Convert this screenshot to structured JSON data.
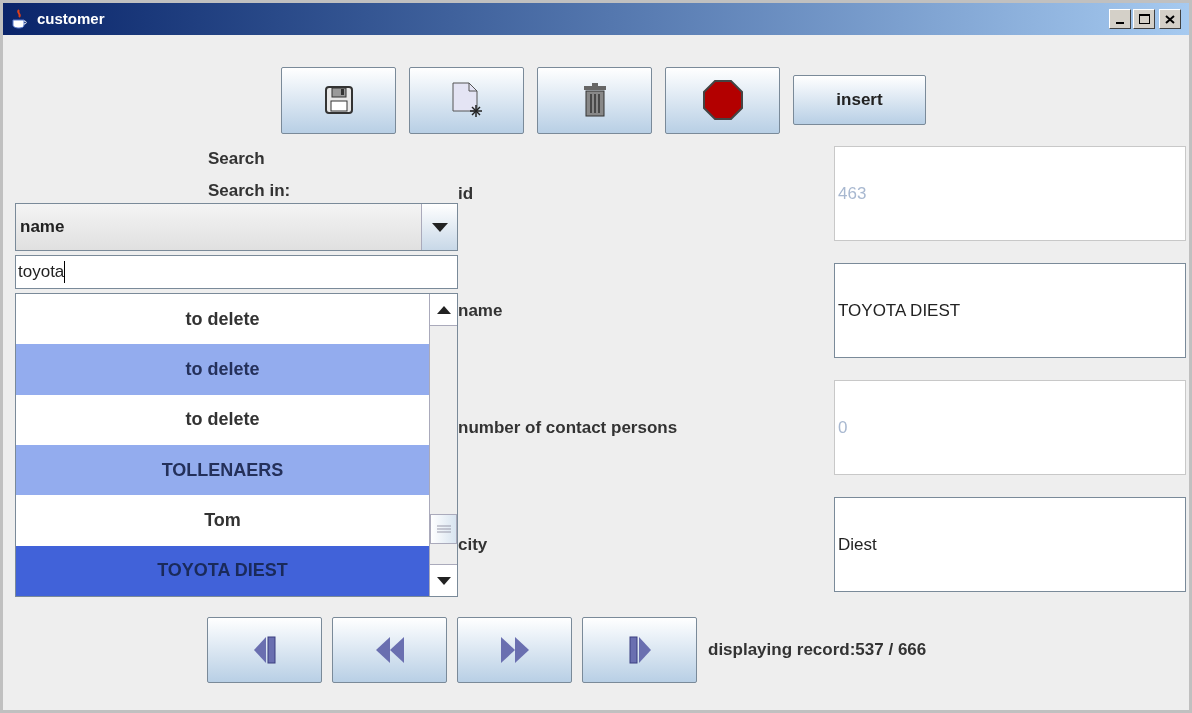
{
  "window": {
    "title": "customer"
  },
  "toolbar": {
    "buttons": [
      {
        "kind": "save"
      },
      {
        "kind": "new"
      },
      {
        "kind": "delete"
      },
      {
        "kind": "stop"
      }
    ],
    "insert_label": "insert"
  },
  "search": {
    "title": "Search",
    "search_in_label": "Search in:",
    "field_choice": "name",
    "query": "toyota",
    "results": [
      {
        "label": "to delete",
        "selected": false
      },
      {
        "label": "to delete",
        "selected": false
      },
      {
        "label": "to delete",
        "selected": false
      },
      {
        "label": "TOLLENAERS",
        "selected": false
      },
      {
        "label": "Tom",
        "selected": false
      },
      {
        "label": "TOYOTA DIEST",
        "selected": true
      }
    ]
  },
  "fields": [
    {
      "label": "id",
      "value": "463",
      "disabled": true
    },
    {
      "label": "name",
      "value": "TOYOTA DIEST",
      "disabled": false
    },
    {
      "label": "number of contact persons",
      "value": "0",
      "disabled": true
    },
    {
      "label": "city",
      "value": "Diest",
      "disabled": false
    }
  ],
  "navigation": {
    "buttons": [
      {
        "kind": "first"
      },
      {
        "kind": "previous"
      },
      {
        "kind": "next"
      },
      {
        "kind": "last"
      }
    ],
    "status": "displaying record:537 / 666"
  }
}
